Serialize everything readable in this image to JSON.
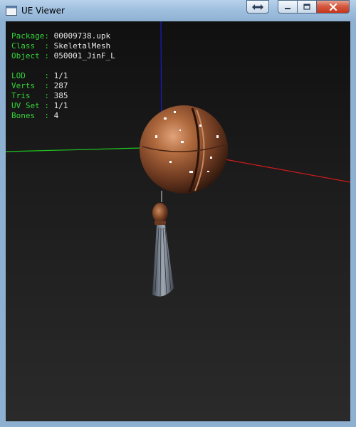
{
  "window": {
    "title": "UE Viewer",
    "buttons": [
      "restore-button",
      "minimize-button",
      "maximize-button",
      "close-button"
    ]
  },
  "info": {
    "package_label": "Package: ",
    "package": "00009738.upk",
    "class_label": "Class  : ",
    "class": "SkeletalMesh",
    "object_label": "Object : ",
    "object": "050001_JinF_L",
    "lod_label": "LOD    : ",
    "lod": "1/1",
    "verts_label": "Verts  : ",
    "verts": "287",
    "tris_label": "Tris   : ",
    "tris": "385",
    "uvset_label": "UV Set : ",
    "uvset": "1/1",
    "bones_label": "Bones  : ",
    "bones": "4"
  },
  "colors": {
    "label": "#35d33a",
    "value": "#e8e8e8",
    "axis_x": "#d11a1a",
    "axis_y": "#20c020",
    "axis_z": "#1a1ad0",
    "bronze": "#8b4a2a"
  }
}
